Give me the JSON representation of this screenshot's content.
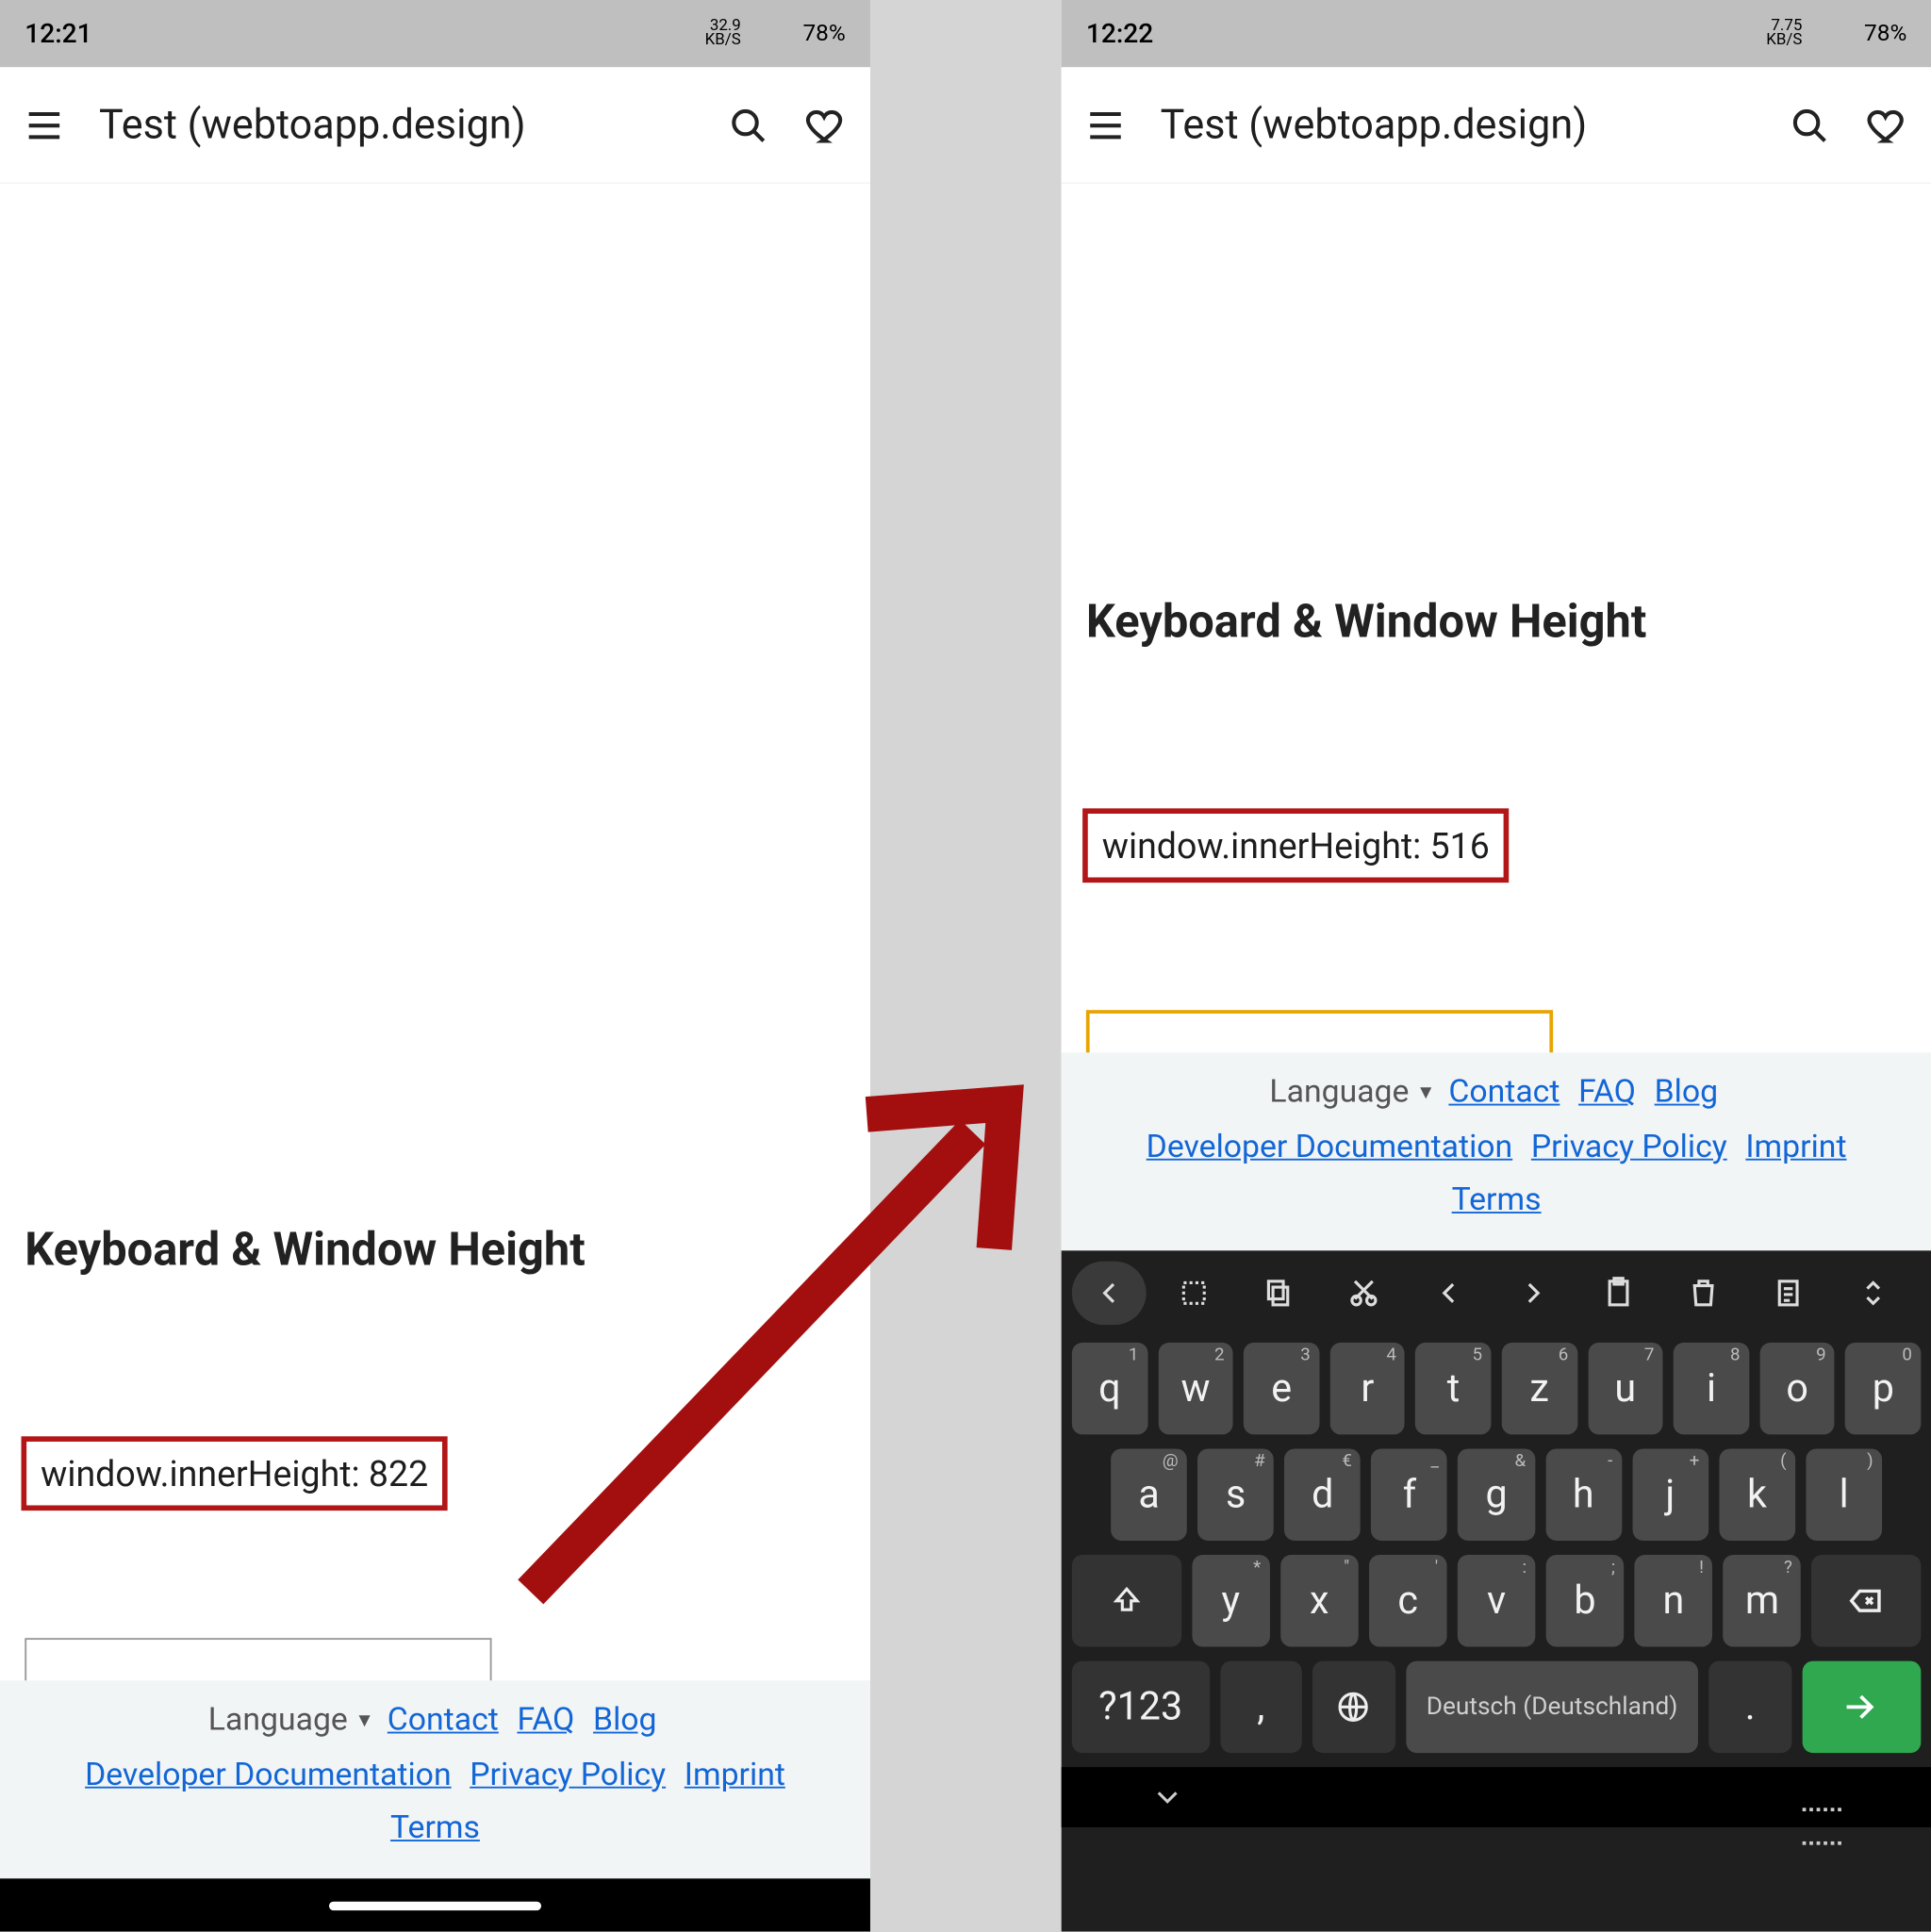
{
  "left": {
    "status": {
      "time": "12:21",
      "netspeed_top": "32.9",
      "netspeed_bot": "KB/S",
      "battery": "78%"
    },
    "appbar": {
      "title": "Test (webtoapp.design)"
    },
    "section_title": "Keyboard & Window Height",
    "height_line": "window.innerHeight: 822",
    "footer": {
      "language": "Language",
      "contact": "Contact",
      "faq": "FAQ",
      "blog": "Blog",
      "devdoc": "Developer Documentation",
      "privacy": "Privacy Policy",
      "imprint": "Imprint",
      "terms": "Terms"
    }
  },
  "right": {
    "status": {
      "time": "12:22",
      "netspeed_top": "7.75",
      "netspeed_bot": "KB/S",
      "battery": "78%"
    },
    "appbar": {
      "title": "Test (webtoapp.design)"
    },
    "section_title": "Keyboard & Window Height",
    "height_line": "window.innerHeight: 516",
    "footer": {
      "language": "Language",
      "contact": "Contact",
      "faq": "FAQ",
      "blog": "Blog",
      "devdoc": "Developer Documentation",
      "privacy": "Privacy Policy",
      "imprint": "Imprint",
      "terms": "Terms"
    }
  },
  "kb": {
    "row1": [
      {
        "k": "q",
        "s": "1"
      },
      {
        "k": "w",
        "s": "2"
      },
      {
        "k": "e",
        "s": "3"
      },
      {
        "k": "r",
        "s": "4"
      },
      {
        "k": "t",
        "s": "5"
      },
      {
        "k": "z",
        "s": "6"
      },
      {
        "k": "u",
        "s": "7"
      },
      {
        "k": "i",
        "s": "8"
      },
      {
        "k": "o",
        "s": "9"
      },
      {
        "k": "p",
        "s": "0"
      }
    ],
    "row2": [
      {
        "k": "a",
        "s": "@"
      },
      {
        "k": "s",
        "s": "#"
      },
      {
        "k": "d",
        "s": "€"
      },
      {
        "k": "f",
        "s": "_"
      },
      {
        "k": "g",
        "s": "&"
      },
      {
        "k": "h",
        "s": "-"
      },
      {
        "k": "j",
        "s": "+"
      },
      {
        "k": "k",
        "s": "("
      },
      {
        "k": "l",
        "s": ")"
      }
    ],
    "row3": [
      {
        "k": "y",
        "s": "*"
      },
      {
        "k": "x",
        "s": "\""
      },
      {
        "k": "c",
        "s": "'"
      },
      {
        "k": "v",
        "s": ":"
      },
      {
        "k": "b",
        "s": ";"
      },
      {
        "k": "n",
        "s": "!"
      },
      {
        "k": "m",
        "s": "?"
      }
    ],
    "nums": "?123",
    "comma": ",",
    "space": "Deutsch (Deutschland)",
    "period": "."
  }
}
